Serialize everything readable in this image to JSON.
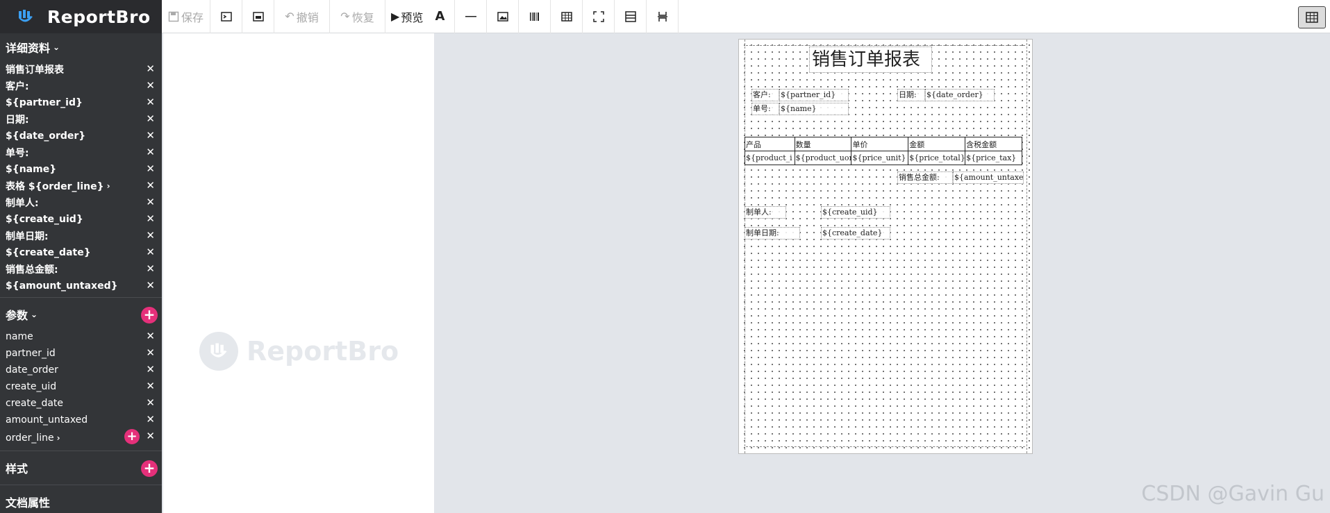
{
  "app": {
    "logo_text": "ReportBro"
  },
  "toolbar": {
    "save": "保存",
    "undo": "撤销",
    "redo": "恢复",
    "preview": "预览"
  },
  "sidebar": {
    "details_title": "详细资料",
    "details_items": [
      "销售订单报表",
      "客户:",
      "${partner_id}",
      "日期:",
      "${date_order}",
      "单号:",
      "${name}",
      "表格 ${order_line}",
      "制单人:",
      "${create_uid}",
      "制单日期:",
      "${create_date}",
      "销售总金额:",
      "${amount_untaxed}"
    ],
    "params_title": "参数",
    "params_items": [
      "name",
      "partner_id",
      "date_order",
      "create_uid",
      "create_date",
      "amount_untaxed",
      "order_line"
    ],
    "styles_title": "样式",
    "doc_props_title": "文档属性"
  },
  "watermark": {
    "text": "ReportBro"
  },
  "document": {
    "title": "销售订单报表",
    "customer_label": "客户:",
    "customer_value": "${partner_id}",
    "date_label": "日期:",
    "date_value": "${date_order}",
    "number_label": "单号:",
    "number_value": "${name}",
    "table_headers": [
      "产品",
      "数量",
      "单价",
      "金额",
      "含税金额"
    ],
    "table_row": [
      "${product_i",
      "${product_uom",
      "${price_unit}",
      "${price_total}",
      "${price_tax}"
    ],
    "total_label": "销售总金额:",
    "total_value": "${amount_untaxed",
    "creator_label": "制单人:",
    "creator_value": "${create_uid}",
    "create_date_label": "制单日期:",
    "create_date_value": "${create_date}"
  },
  "footer_watermark": "CSDN @Gavin Gu",
  "colors": {
    "sidebar_bg": "#333538",
    "accent": "#e5307a",
    "canvas_bg": "#e2e5ea"
  }
}
